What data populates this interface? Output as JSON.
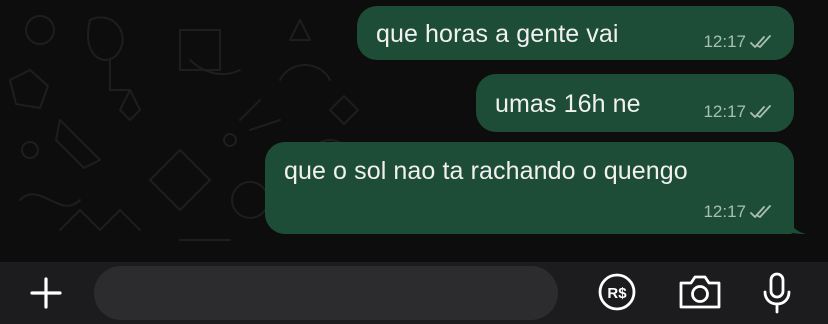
{
  "messages": [
    {
      "text": "que horas a gente vai",
      "time": "12:17",
      "status": "read"
    },
    {
      "text": "umas 16h ne",
      "time": "12:17",
      "status": "read"
    },
    {
      "text": "que o sol nao ta rachando o quengo",
      "time": "12:17",
      "status": "read"
    }
  ],
  "input_bar": {
    "message_value": "",
    "icons": [
      "plus-icon",
      "sticker-icon",
      "payment-icon",
      "camera-icon",
      "microphone-icon"
    ],
    "payment_label": "R$"
  },
  "colors": {
    "background": "#0d0d0d",
    "outgoing_bubble": "#1e4d37",
    "input_bar": "#1c1c1e",
    "input_field": "#2c2c2e",
    "icons": "#ffffff"
  }
}
